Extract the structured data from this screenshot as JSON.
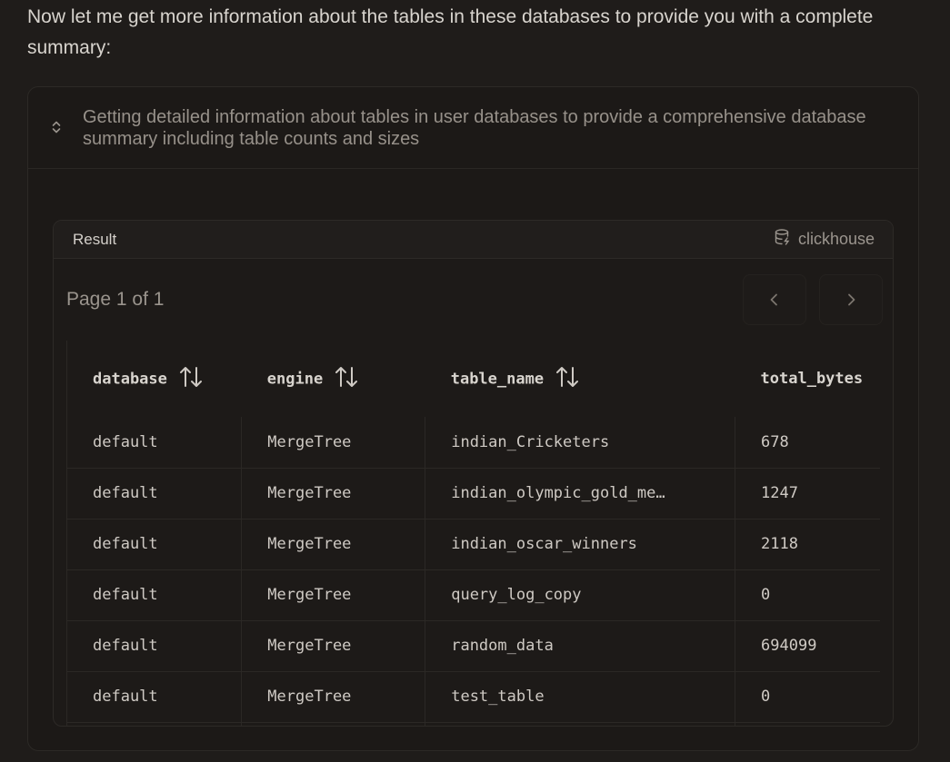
{
  "intro_text": "Now let me get more information about the tables in these databases to provide you with a complete summary:",
  "tool_call": {
    "title": "Getting detailed information about tables in user databases to provide a comprehensive database summary including table counts and sizes"
  },
  "result": {
    "label": "Result",
    "source": "clickhouse",
    "page_text": "Page 1 of 1",
    "columns": [
      "database",
      "engine",
      "table_name",
      "total_bytes"
    ],
    "rows": [
      [
        "default",
        "MergeTree",
        "indian_Cricketers",
        "678"
      ],
      [
        "default",
        "MergeTree",
        "indian_olympic_gold_me…",
        "1247"
      ],
      [
        "default",
        "MergeTree",
        "indian_oscar_winners",
        "2118"
      ],
      [
        "default",
        "MergeTree",
        "query_log_copy",
        "0"
      ],
      [
        "default",
        "MergeTree",
        "random_data",
        "694099"
      ],
      [
        "default",
        "MergeTree",
        "test_table",
        "0"
      ]
    ]
  }
}
